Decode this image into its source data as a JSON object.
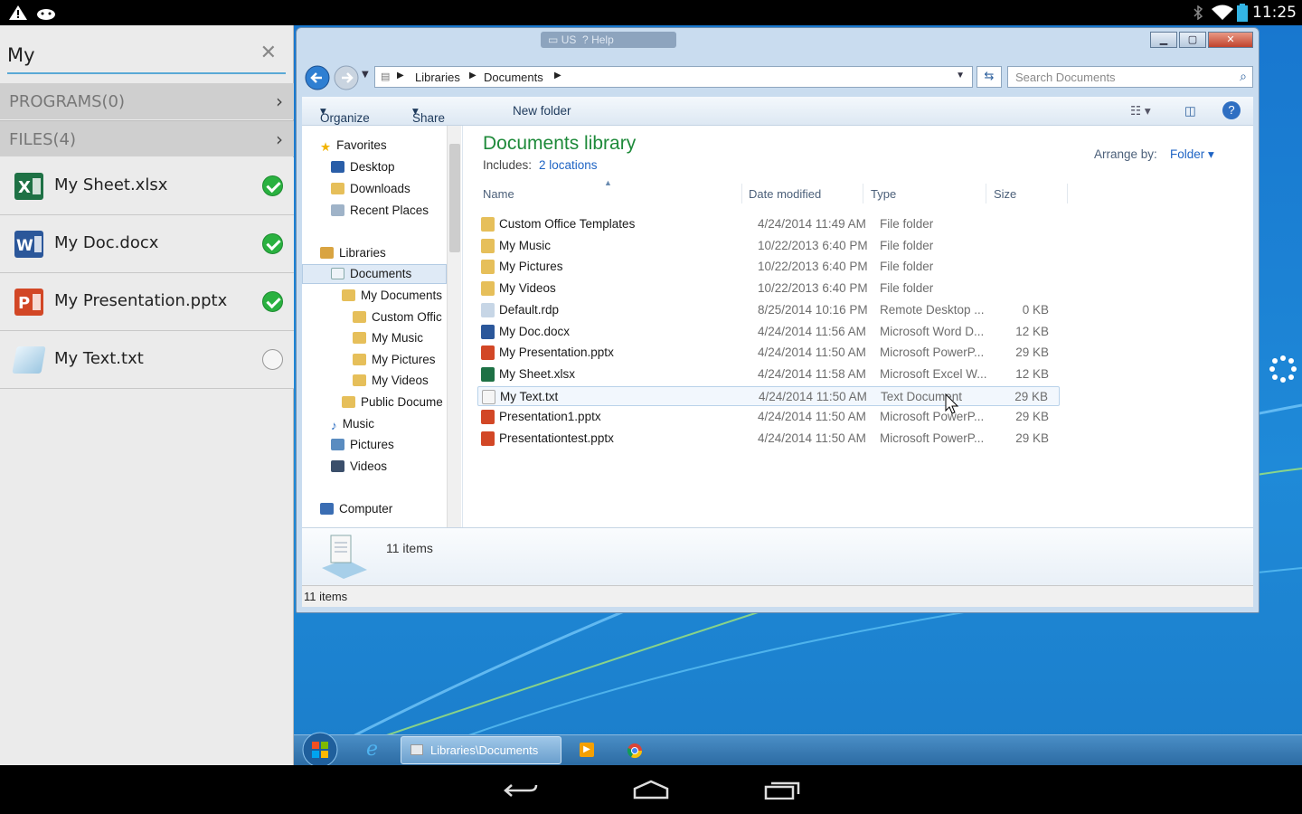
{
  "android": {
    "clock": "11:25"
  },
  "left_panel": {
    "search": {
      "value": "My",
      "placeholder": ""
    },
    "programs_header": "PROGRAMS(0)",
    "files_header": "FILES(4)",
    "files": [
      {
        "label": "My Sheet.xlsx",
        "checked": true,
        "icon": "excel-icon"
      },
      {
        "label": "My Doc.docx",
        "checked": true,
        "icon": "word-icon"
      },
      {
        "label": "My Presentation.pptx",
        "checked": true,
        "icon": "powerpoint-icon"
      },
      {
        "label": "My Text.txt",
        "checked": false,
        "icon": "text-file-icon"
      }
    ]
  },
  "window": {
    "ime": {
      "lang": "US",
      "help": "Help"
    },
    "breadcrumb": [
      "Libraries",
      "Documents"
    ],
    "search_placeholder": "Search Documents",
    "toolbar": {
      "organize": "Organize",
      "share": "Share with",
      "new_folder": "New folder"
    },
    "nav": {
      "favorites": "Favorites",
      "desktop": "Desktop",
      "downloads": "Downloads",
      "recent": "Recent Places",
      "libraries": "Libraries",
      "documents": "Documents",
      "my_documents": "My Documents",
      "custom_office": "Custom Offic",
      "my_music": "My Music",
      "my_pictures": "My Pictures",
      "my_videos": "My Videos",
      "public_docs": "Public Docume",
      "music": "Music",
      "pictures": "Pictures",
      "videos": "Videos",
      "computer": "Computer"
    },
    "library": {
      "title": "Documents library",
      "includes_label": "Includes:",
      "includes_link": "2 locations",
      "arrange_label": "Arrange by:",
      "arrange_value": "Folder"
    },
    "columns": {
      "name": "Name",
      "date": "Date modified",
      "type": "Type",
      "size": "Size"
    },
    "files": [
      {
        "name": "Custom Office Templates",
        "date": "4/24/2014 11:49 AM",
        "type": "File folder",
        "size": "",
        "kind": "folder"
      },
      {
        "name": "My Music",
        "date": "10/22/2013 6:40 PM",
        "type": "File folder",
        "size": "",
        "kind": "folder"
      },
      {
        "name": "My Pictures",
        "date": "10/22/2013 6:40 PM",
        "type": "File folder",
        "size": "",
        "kind": "folder"
      },
      {
        "name": "My Videos",
        "date": "10/22/2013 6:40 PM",
        "type": "File folder",
        "size": "",
        "kind": "folder"
      },
      {
        "name": "Default.rdp",
        "date": "8/25/2014 10:16 PM",
        "type": "Remote Desktop ...",
        "size": "0 KB",
        "kind": "rdp"
      },
      {
        "name": "My Doc.docx",
        "date": "4/24/2014 11:56 AM",
        "type": "Microsoft Word D...",
        "size": "12 KB",
        "kind": "word"
      },
      {
        "name": "My Presentation.pptx",
        "date": "4/24/2014 11:50 AM",
        "type": "Microsoft PowerP...",
        "size": "29 KB",
        "kind": "ppt"
      },
      {
        "name": "My Sheet.xlsx",
        "date": "4/24/2014 11:58 AM",
        "type": "Microsoft Excel W...",
        "size": "12 KB",
        "kind": "excel"
      },
      {
        "name": "My Text.txt",
        "date": "4/24/2014 11:50 AM",
        "type": "Text Document",
        "size": "29 KB",
        "kind": "txt"
      },
      {
        "name": "Presentation1.pptx",
        "date": "4/24/2014 11:50 AM",
        "type": "Microsoft PowerP...",
        "size": "29 KB",
        "kind": "ppt"
      },
      {
        "name": "Presentationtest.pptx",
        "date": "4/24/2014 11:50 AM",
        "type": "Microsoft PowerP...",
        "size": "29 KB",
        "kind": "ppt"
      }
    ],
    "details_count": "11 items",
    "status_count": "11 items"
  },
  "taskbar": {
    "active_window": "Libraries\\Documents"
  },
  "colors": {
    "accent": "#5aa9d6",
    "library_title": "#1e8a3a",
    "link": "#1f64c4",
    "check": "#2ab140"
  }
}
